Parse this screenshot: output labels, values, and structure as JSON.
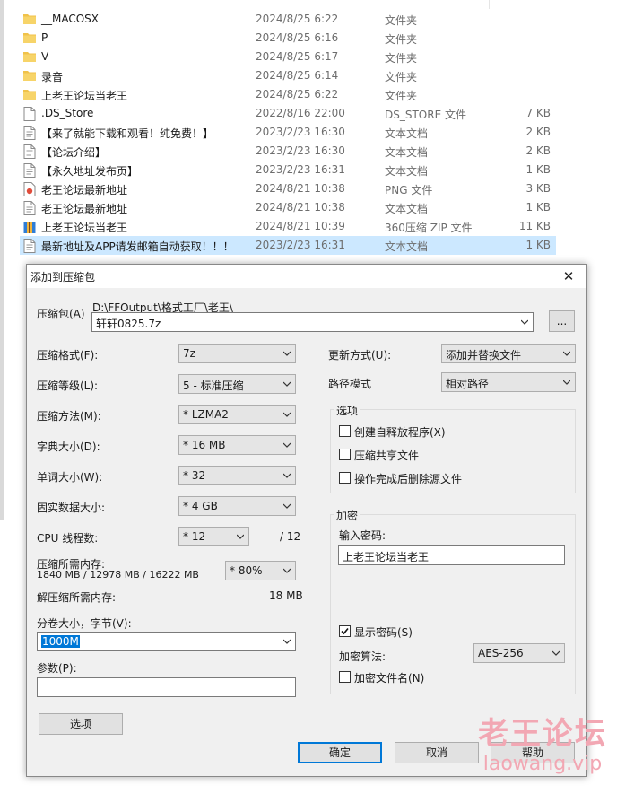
{
  "files": [
    {
      "name": "__MACOSX",
      "date": "2024/8/25 6:22",
      "type": "文件夹",
      "size": "",
      "icon": "folder-icon"
    },
    {
      "name": "P",
      "date": "2024/8/25 6:16",
      "type": "文件夹",
      "size": "",
      "icon": "folder-icon"
    },
    {
      "name": "V",
      "date": "2024/8/25 6:17",
      "type": "文件夹",
      "size": "",
      "icon": "folder-icon"
    },
    {
      "name": "录音",
      "date": "2024/8/25 6:14",
      "type": "文件夹",
      "size": "",
      "icon": "folder-icon"
    },
    {
      "name": "上老王论坛当老王",
      "date": "2024/8/25 6:22",
      "type": "文件夹",
      "size": "",
      "icon": "folder-icon"
    },
    {
      "name": ".DS_Store",
      "date": "2022/8/16 22:00",
      "type": "DS_STORE 文件",
      "size": "7 KB",
      "icon": "file-icon"
    },
    {
      "name": "【来了就能下载和观看！纯免费！】",
      "date": "2023/2/23 16:30",
      "type": "文本文档",
      "size": "2 KB",
      "icon": "text-file-icon"
    },
    {
      "name": "【论坛介绍】",
      "date": "2023/2/23 16:30",
      "type": "文本文档",
      "size": "2 KB",
      "icon": "text-file-icon"
    },
    {
      "name": "【永久地址发布页】",
      "date": "2023/2/23 16:31",
      "type": "文本文档",
      "size": "1 KB",
      "icon": "text-file-icon"
    },
    {
      "name": "老王论坛最新地址",
      "date": "2024/8/21 10:38",
      "type": "PNG 文件",
      "size": "3 KB",
      "icon": "png-file-icon"
    },
    {
      "name": "老王论坛最新地址",
      "date": "2024/8/21 10:38",
      "type": "文本文档",
      "size": "1 KB",
      "icon": "text-file-icon"
    },
    {
      "name": "上老王论坛当老王",
      "date": "2024/8/21 10:39",
      "type": "360压缩 ZIP 文件",
      "size": "11 KB",
      "icon": "zip-file-icon"
    },
    {
      "name": "最新地址及APP请发邮箱自动获取！！！",
      "date": "2023/2/23 16:31",
      "type": "文本文档",
      "size": "1 KB",
      "icon": "text-file-icon",
      "selected": true
    }
  ],
  "dialog": {
    "title": "添加到压缩包",
    "archive_label": "压缩包(A)",
    "archive_path": "D:\\FFOutput\\格式工厂\\老王\\",
    "archive_name": "轩轩0825.7z",
    "browse_label": "...",
    "format_label": "压缩格式(F):",
    "format_value": "7z",
    "level_label": "压缩等级(L):",
    "level_value": "5 - 标准压缩",
    "method_label": "压缩方法(M):",
    "method_value": "* LZMA2",
    "dict_label": "字典大小(D):",
    "dict_value": "* 16 MB",
    "word_label": "单词大小(W):",
    "word_value": "* 32",
    "solid_label": "固实数据大小:",
    "solid_value": "* 4 GB",
    "threads_label": "CPU 线程数:",
    "threads_value": "* 12",
    "threads_max": "/ 12",
    "mem_comp_label": "压缩所需内存:",
    "mem_comp_value": "1840 MB / 12978 MB / 16222 MB",
    "mem_percent": "* 80%",
    "mem_decomp_label": "解压缩所需内存:",
    "mem_decomp_value": "18 MB",
    "split_label": "分卷大小，字节(V):",
    "split_value": "1000M",
    "params_label": "参数(P):",
    "params_value": "",
    "options_button": "选项",
    "update_label": "更新方式(U):",
    "update_value": "添加并替换文件",
    "path_label": "路径模式",
    "path_value": "相对路径",
    "options_group": "选项",
    "opt_sfx": "创建自释放程序(X)",
    "opt_sfx_checked": false,
    "opt_shared": "压缩共享文件",
    "opt_shared_checked": false,
    "opt_delete": "操作完成后删除源文件",
    "opt_delete_checked": false,
    "encrypt_group": "加密",
    "password_label": "输入密码:",
    "password_value": "上老王论坛当老王",
    "show_password": "显示密码(S)",
    "show_password_checked": true,
    "enc_method_label": "加密算法:",
    "enc_method_value": "AES-256",
    "encrypt_names": "加密文件名(N)",
    "encrypt_names_checked": false,
    "ok": "确定",
    "cancel": "取消",
    "help": "帮助"
  },
  "watermark": {
    "line1": "老王论坛",
    "line2": "laowang.vip"
  },
  "colors": {
    "accent": "#0078d7",
    "selection": "#cce8ff",
    "folder": "#f0c24a",
    "watermark": "#f2a7b3"
  }
}
